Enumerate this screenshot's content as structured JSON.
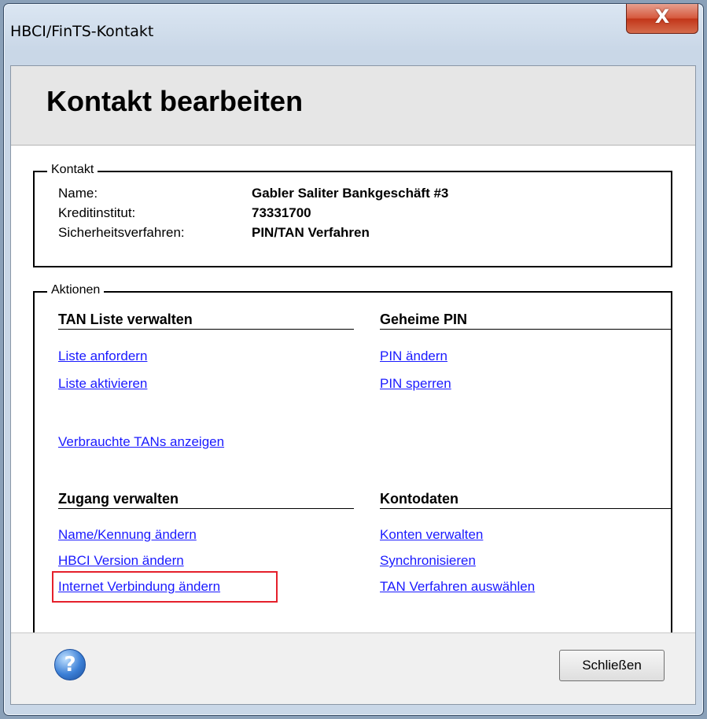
{
  "window": {
    "title": "HBCI/FinTS-Kontakt",
    "close_glyph": "X"
  },
  "header": {
    "title": "Kontakt bearbeiten"
  },
  "kontakt": {
    "legend": "Kontakt",
    "fields": [
      {
        "label": "Name:",
        "value": "Gabler Saliter Bankgeschäft #3"
      },
      {
        "label": "Kreditinstitut:",
        "value": "73331700"
      },
      {
        "label": "Sicherheitsverfahren:",
        "value": "PIN/TAN Verfahren"
      }
    ]
  },
  "aktionen": {
    "legend": "Aktionen",
    "tan_liste": {
      "heading": "TAN Liste verwalten",
      "links": [
        "Liste anfordern",
        "Liste aktivieren",
        "Verbrauchte TANs anzeigen"
      ]
    },
    "geheime_pin": {
      "heading": "Geheime PIN",
      "links": [
        "PIN ändern",
        "PIN sperren"
      ]
    },
    "zugang": {
      "heading": "Zugang verwalten",
      "links": [
        "Name/Kennung ändern",
        "HBCI Version ändern",
        "Internet Verbindung ändern"
      ]
    },
    "kontodaten": {
      "heading": "Kontodaten",
      "links": [
        "Konten verwalten",
        "Synchronisieren",
        "TAN Verfahren auswählen"
      ]
    }
  },
  "footer": {
    "help_glyph": "?",
    "close_label": "Schließen"
  },
  "colors": {
    "link": "#1a1aff",
    "highlight": "#e5202b"
  },
  "icons": {
    "help": "help-icon",
    "close": "close-icon"
  }
}
